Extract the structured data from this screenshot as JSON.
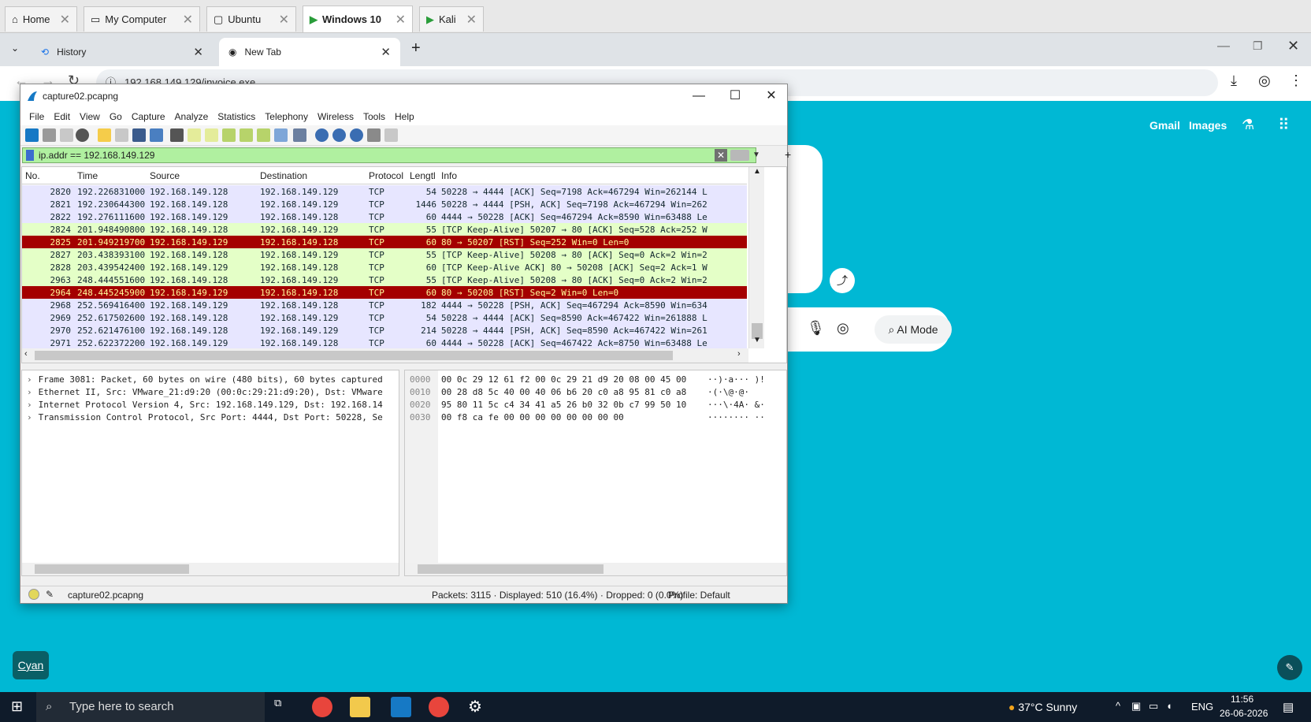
{
  "vm_tabs": [
    {
      "label": "Home"
    },
    {
      "label": "My Computer"
    },
    {
      "label": "Ubuntu"
    },
    {
      "label": "Windows 10"
    },
    {
      "label": "Kali"
    }
  ],
  "browser": {
    "tabs": [
      {
        "label": "History"
      },
      {
        "label": "New Tab"
      }
    ],
    "url": "192.168.149.129/invoice.exe",
    "links": {
      "gmail": "Gmail",
      "images": "Images"
    },
    "ai_mode": "AI Mode",
    "cyan_label": "Cyan"
  },
  "wireshark": {
    "title": "capture02.pcapng",
    "menu": [
      "File",
      "Edit",
      "View",
      "Go",
      "Capture",
      "Analyze",
      "Statistics",
      "Telephony",
      "Wireless",
      "Tools",
      "Help"
    ],
    "filter": "ip.addr == 192.168.149.129",
    "columns": [
      "No.",
      "Time",
      "Source",
      "Destination",
      "Protocol",
      "Lengtl",
      "Info"
    ],
    "packets": [
      {
        "no": "2820",
        "time": "192.226831000",
        "src": "192.168.149.128",
        "dst": "192.168.149.129",
        "proto": "TCP",
        "len": "54",
        "info": "50228 → 4444 [ACK] Seq=7198 Ack=467294 Win=262144 L",
        "style": "tcp"
      },
      {
        "no": "2821",
        "time": "192.230644300",
        "src": "192.168.149.128",
        "dst": "192.168.149.129",
        "proto": "TCP",
        "len": "1446",
        "info": "50228 → 4444 [PSH, ACK] Seq=7198 Ack=467294 Win=262",
        "style": "tcp"
      },
      {
        "no": "2822",
        "time": "192.276111600",
        "src": "192.168.149.129",
        "dst": "192.168.149.128",
        "proto": "TCP",
        "len": "60",
        "info": "4444 → 50228 [ACK] Seq=467294 Ack=8590 Win=63488 Le",
        "style": "tcp"
      },
      {
        "no": "2824",
        "time": "201.948490800",
        "src": "192.168.149.128",
        "dst": "192.168.149.129",
        "proto": "TCP",
        "len": "55",
        "info": "[TCP Keep-Alive] 50207 → 80 [ACK] Seq=528 Ack=252 W",
        "style": "keep"
      },
      {
        "no": "2825",
        "time": "201.949219700",
        "src": "192.168.149.129",
        "dst": "192.168.149.128",
        "proto": "TCP",
        "len": "60",
        "info": "80 → 50207 [RST] Seq=252 Win=0 Len=0",
        "style": "rst"
      },
      {
        "no": "2827",
        "time": "203.438393100",
        "src": "192.168.149.128",
        "dst": "192.168.149.129",
        "proto": "TCP",
        "len": "55",
        "info": "[TCP Keep-Alive] 50208 → 80 [ACK] Seq=0 Ack=2 Win=2",
        "style": "keep"
      },
      {
        "no": "2828",
        "time": "203.439542400",
        "src": "192.168.149.129",
        "dst": "192.168.149.128",
        "proto": "TCP",
        "len": "60",
        "info": "[TCP Keep-Alive ACK] 80 → 50208 [ACK] Seq=2 Ack=1 W",
        "style": "keep"
      },
      {
        "no": "2963",
        "time": "248.444551600",
        "src": "192.168.149.128",
        "dst": "192.168.149.129",
        "proto": "TCP",
        "len": "55",
        "info": "[TCP Keep-Alive] 50208 → 80 [ACK] Seq=0 Ack=2 Win=2",
        "style": "keep"
      },
      {
        "no": "2964",
        "time": "248.445245900",
        "src": "192.168.149.129",
        "dst": "192.168.149.128",
        "proto": "TCP",
        "len": "60",
        "info": "80 → 50208 [RST] Seq=2 Win=0 Len=0",
        "style": "rst"
      },
      {
        "no": "2968",
        "time": "252.569416400",
        "src": "192.168.149.129",
        "dst": "192.168.149.128",
        "proto": "TCP",
        "len": "182",
        "info": "4444 → 50228 [PSH, ACK] Seq=467294 Ack=8590 Win=634",
        "style": "tcp"
      },
      {
        "no": "2969",
        "time": "252.617502600",
        "src": "192.168.149.128",
        "dst": "192.168.149.129",
        "proto": "TCP",
        "len": "54",
        "info": "50228 → 4444 [ACK] Seq=8590 Ack=467422 Win=261888 L",
        "style": "tcp"
      },
      {
        "no": "2970",
        "time": "252.621476100",
        "src": "192.168.149.128",
        "dst": "192.168.149.129",
        "proto": "TCP",
        "len": "214",
        "info": "50228 → 4444 [PSH, ACK] Seq=8590 Ack=467422 Win=261",
        "style": "tcp"
      },
      {
        "no": "2971",
        "time": "252.622372200",
        "src": "192.168.149.129",
        "dst": "192.168.149.128",
        "proto": "TCP",
        "len": "60",
        "info": "4444 → 50228 [ACK] Seq=467422 Ack=8750 Win=63488 Le",
        "style": "tcp"
      }
    ],
    "details": [
      "Frame 3081: Packet, 60 bytes on wire (480 bits), 60 bytes captured",
      "Ethernet II, Src: VMware_21:d9:20 (00:0c:29:21:d9:20), Dst: VMware",
      "Internet Protocol Version 4, Src: 192.168.149.129, Dst: 192.168.14",
      "Transmission Control Protocol, Src Port: 4444, Dst Port: 50228, Se"
    ],
    "bytes": [
      {
        "off": "0000",
        "hex": "00 0c 29 12 61 f2 00 0c  29 21 d9 20 08 00 45 00",
        "ascii": "··)·a··· )!"
      },
      {
        "off": "0010",
        "hex": "00 28 d8 5c 40 00 40 06  b6 20 c0 a8 95 81 c0 a8",
        "ascii": "·(·\\@·@· "
      },
      {
        "off": "0020",
        "hex": "95 80 11 5c c4 34 41 a5  26 b0 32 0b c7 99 50 10",
        "ascii": "···\\·4A· &·"
      },
      {
        "off": "0030",
        "hex": "00 f8 ca fe 00 00 00 00  00 00 00 00",
        "ascii": "········ ··"
      }
    ],
    "status": {
      "file": "capture02.pcapng",
      "packets": "Packets: 3115 · Displayed: 510 (16.4%) · Dropped: 0 (0.0%)",
      "profile": "Profile: Default"
    }
  },
  "taskbar": {
    "search_placeholder": "Type here to search",
    "weather": "37°C  Sunny",
    "lang": "ENG",
    "time": "11:56",
    "date": "26-06-2026"
  }
}
